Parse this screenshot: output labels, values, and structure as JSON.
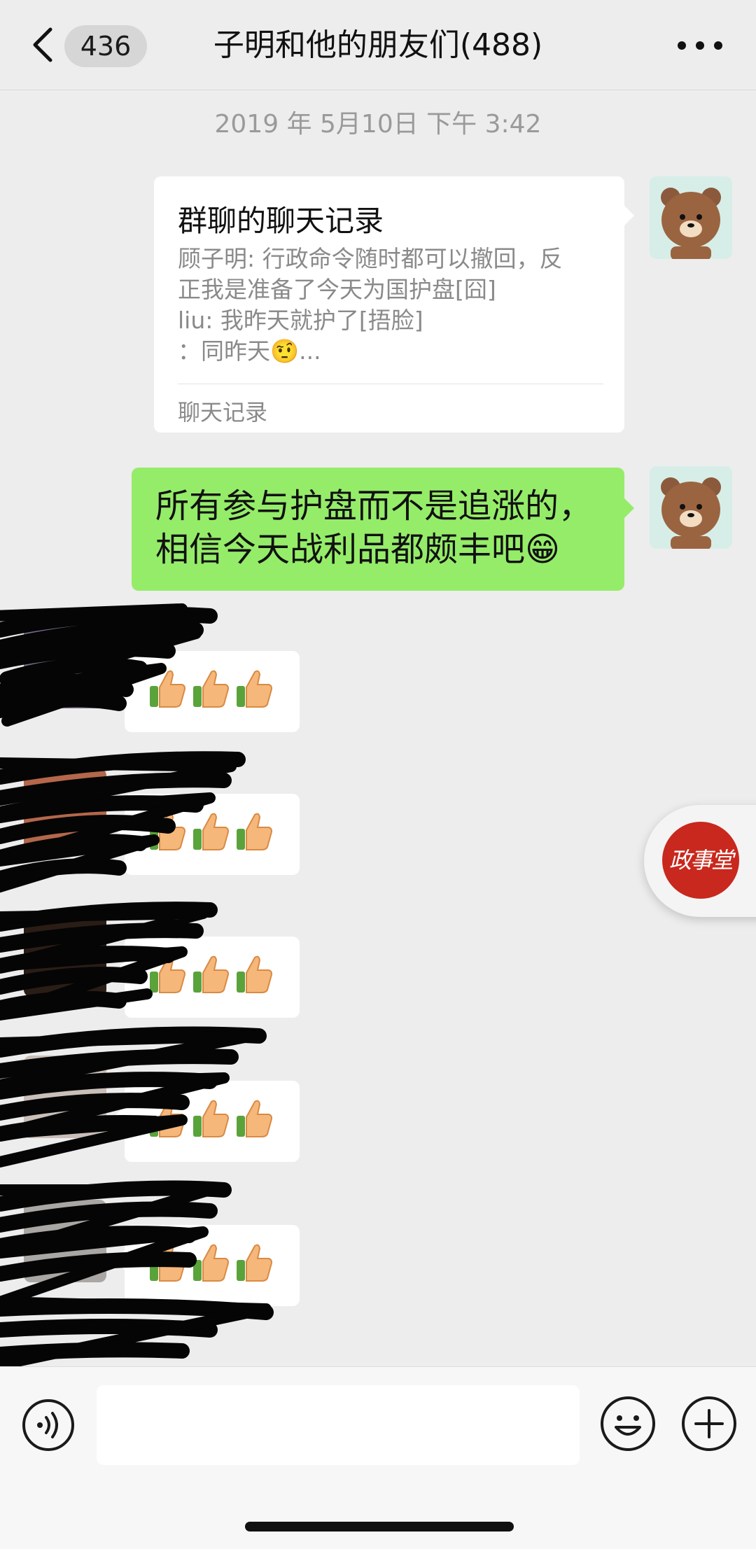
{
  "navbar": {
    "back_icon": "chevron-left-icon",
    "unread_count": "436",
    "title": "子明和他的朋友们(488)",
    "more_icon": "ellipsis-icon"
  },
  "timestamp": "2019 年 5月10日 下午 3:42",
  "chat_record_card": {
    "title": "群聊的聊天记录",
    "preview_lines": [
      "顾子明: 行政命令随时都可以撤回，反",
      "正我是准备了今天为国护盘[囧]",
      "liu: 我昨天就护了[捂脸]",
      "：同昨天🤨..."
    ],
    "footer": "聊天记录"
  },
  "sent_message": {
    "lines": [
      "所有参与护盘而不是追涨的，",
      "相信今天战利品都颇丰吧😁"
    ]
  },
  "replies": [
    {
      "content": "👍👍👍",
      "sender": "redacted"
    },
    {
      "content": "👍👍👍",
      "sender": "redacted"
    },
    {
      "content": "👍👍👍",
      "sender": "redacted"
    },
    {
      "content": "👍👍👍",
      "sender": "redacted"
    },
    {
      "content": "👍👍👍",
      "sender": "redacted"
    }
  ],
  "floating_badge": {
    "label": "政事堂"
  },
  "input_bar": {
    "voice_icon": "voice-icon",
    "input_value": "",
    "emoji_icon": "emoji-icon",
    "plus_icon": "plus-icon"
  },
  "colors": {
    "background": "#ededed",
    "sent_bubble": "#95ec69",
    "received_bubble": "#ffffff",
    "seal_red": "#c8281d"
  }
}
